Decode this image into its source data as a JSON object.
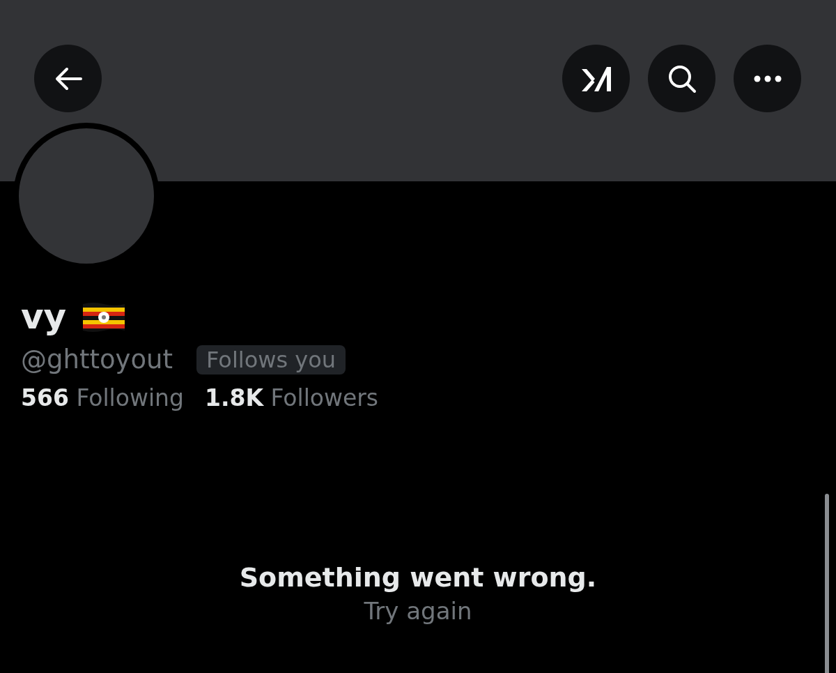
{
  "header": {
    "buttons": [
      {
        "kind": "back"
      },
      {
        "kind": "grok"
      },
      {
        "kind": "search"
      },
      {
        "kind": "more"
      }
    ]
  },
  "profile": {
    "name": "vy",
    "handle": "@ghttoyout",
    "badge": "Follows you",
    "stats": [
      {
        "count": "566",
        "label": "Following"
      },
      {
        "count": "1.8K",
        "label": "Followers"
      }
    ]
  },
  "error": {
    "message": "Something went wrong.",
    "action": "Try again"
  }
}
